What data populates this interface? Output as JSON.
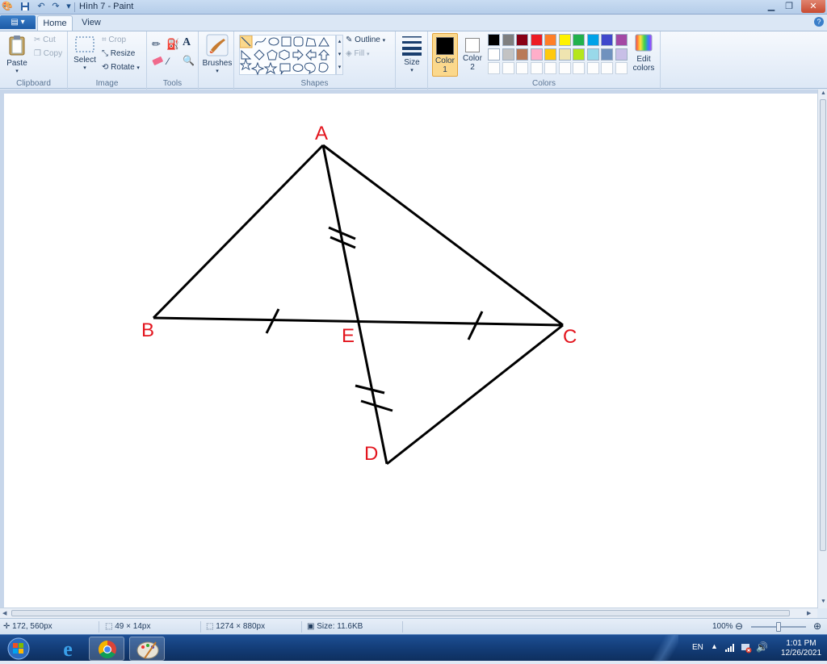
{
  "window": {
    "title": "Hình 7 - Paint"
  },
  "tabs": {
    "app_menu": "▤ ▾",
    "home": "Home",
    "view": "View",
    "help": "?"
  },
  "ribbon": {
    "clipboard": {
      "label": "Clipboard",
      "paste": "Paste",
      "cut": "Cut",
      "copy": "Copy"
    },
    "image": {
      "label": "Image",
      "select": "Select",
      "crop": "Crop",
      "resize": "Resize",
      "rotate": "Rotate"
    },
    "tools": {
      "label": "Tools"
    },
    "brushes": {
      "label": "Brushes"
    },
    "shapes": {
      "label": "Shapes",
      "outline": "Outline",
      "fill": "Fill"
    },
    "size": {
      "label": "Size"
    },
    "colors": {
      "label": "Colors",
      "color1": "Color\n1",
      "color1_line1": "Color",
      "color1_line2": "1",
      "color2_line1": "Color",
      "color2_line2": "2",
      "edit_line1": "Edit",
      "edit_line2": "colors",
      "row1": [
        "#000000",
        "#7f7f7f",
        "#880015",
        "#ed1c24",
        "#ff7f27",
        "#fff200",
        "#22b14c",
        "#00a2e8",
        "#3f48cc",
        "#a349a4"
      ],
      "row2": [
        "#ffffff",
        "#c3c3c3",
        "#b97a57",
        "#ffaec9",
        "#ffc90e",
        "#efe4b0",
        "#b5e61d",
        "#99d9ea",
        "#7092be",
        "#c8bfe7"
      ]
    }
  },
  "drawing": {
    "label_a": "A",
    "label_b": "B",
    "label_c": "C",
    "label_d": "D",
    "label_e": "E",
    "label_color": "#e3151e"
  },
  "status": {
    "cursor_pos": "172, 560px",
    "selection_size": "49 × 14px",
    "image_size": "1274 × 880px",
    "file_size": "Size: 11.6KB",
    "zoom": "100%"
  },
  "taskbar": {
    "lang": "EN",
    "time": "1:01 PM",
    "date": "12/26/2021"
  }
}
